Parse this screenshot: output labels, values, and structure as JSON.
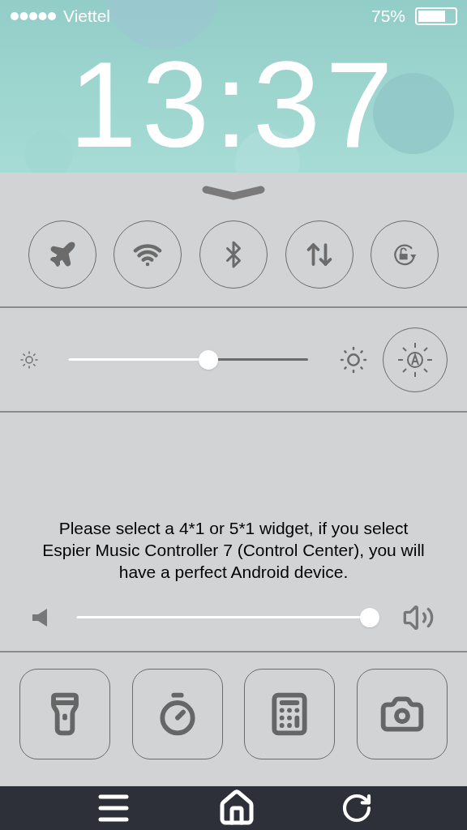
{
  "status_bar": {
    "carrier": "Viettel",
    "battery_percent": "75%"
  },
  "lock_screen": {
    "time": "13:37"
  },
  "toggles": [
    {
      "kind": "airplane",
      "on": false
    },
    {
      "kind": "wifi",
      "on": false
    },
    {
      "kind": "bluetooth",
      "on": false
    },
    {
      "kind": "data",
      "on": false
    },
    {
      "kind": "rotation_lock",
      "on": false
    }
  ],
  "brightness": {
    "level": 0.585,
    "auto": false
  },
  "message": "Please select a 4*1 or 5*1 widget, if you select Espier Music Controller 7 (Control Center), you will have a perfect Android device.",
  "volume": {
    "level": 0.99
  },
  "shortcuts": [
    {
      "kind": "flashlight"
    },
    {
      "kind": "timer"
    },
    {
      "kind": "calculator"
    },
    {
      "kind": "camera"
    }
  ]
}
